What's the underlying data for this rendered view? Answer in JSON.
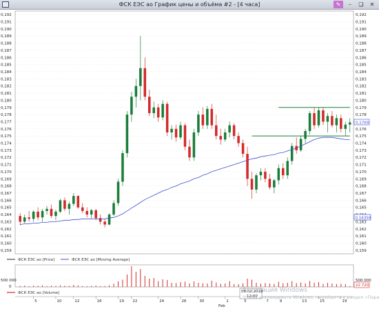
{
  "window": {
    "title": "ФСК ЕЭС ао График цены и объёма #2 - [4 часа]",
    "buttons": {
      "highlight": "✎",
      "minimize": "–",
      "restore": "❏",
      "close": "✕"
    }
  },
  "colors": {
    "up": "#1b7d3a",
    "down": "#d22a2a",
    "ma": "#3a4fd2",
    "volume": "#d22a2a",
    "grid": "#d6d6d6",
    "level_line": "#1b7d3a"
  },
  "price_axis": {
    "ticks": [
      "0,159",
      "0,160",
      "0,161",
      "0,162",
      "0,163",
      "0,164",
      "0,165",
      "0,166",
      "0,167",
      "0,168",
      "0,169",
      "0,170",
      "0,171",
      "0,172",
      "0,173",
      "0,174",
      "0,175",
      "0,176",
      "0,177",
      "0,178",
      "0,179",
      "0,180",
      "0,181",
      "0,182",
      "0,183",
      "0,184",
      "0,185",
      "0,186",
      "0,187",
      "0,188",
      "0,189",
      "0,190",
      "0,191",
      "0,192"
    ],
    "min": 0.1585,
    "max": 0.1925,
    "last_price_label": "0,1769",
    "ma_price_label": "0,16358"
  },
  "legend": {
    "price": "ФСК ЕЭС ао [Price]",
    "ma": "ФСК ЕЭС ао [Moving Average]",
    "volume": "ФСК ЕЭС ао [Volume]"
  },
  "volume_axis": {
    "ticks": [
      "500 000",
      "0"
    ],
    "last_label": "22 720"
  },
  "time_axis": {
    "labels": [
      "5",
      "10",
      "12",
      "16",
      "19",
      "22",
      "24",
      "26",
      "30",
      "1",
      "5",
      "7",
      "9",
      "13",
      "15",
      "19"
    ],
    "month_label": "Feb",
    "crosshair_date": "06.02.2018",
    "crosshair_time": "12:00"
  },
  "level_lines": [
    0.179,
    0.175
  ],
  "watermark": {
    "line1": "Активация Windows",
    "line2": "Чтобы активировать Windows, перейдите в раздел «Параметры»."
  },
  "chart_data": {
    "type": "candlestick",
    "series": [
      {
        "name": "ФСК ЕЭС ао [Price]",
        "candles": [
          [
            0.1638,
            0.1642,
            0.1625,
            0.163
          ],
          [
            0.163,
            0.164,
            0.1628,
            0.1636
          ],
          [
            0.1636,
            0.1645,
            0.163,
            0.1634
          ],
          [
            0.1634,
            0.1646,
            0.163,
            0.1644
          ],
          [
            0.1644,
            0.165,
            0.1632,
            0.1636
          ],
          [
            0.1636,
            0.1648,
            0.163,
            0.1645
          ],
          [
            0.1645,
            0.1652,
            0.164,
            0.1648
          ],
          [
            0.1648,
            0.1654,
            0.1635,
            0.1638
          ],
          [
            0.1638,
            0.1647,
            0.1632,
            0.1644
          ],
          [
            0.1644,
            0.1662,
            0.1642,
            0.166
          ],
          [
            0.166,
            0.1664,
            0.1645,
            0.1648
          ],
          [
            0.1648,
            0.1658,
            0.164,
            0.1655
          ],
          [
            0.1655,
            0.167,
            0.1652,
            0.1666
          ],
          [
            0.1666,
            0.1667,
            0.1648,
            0.165
          ],
          [
            0.165,
            0.1656,
            0.1642,
            0.1645
          ],
          [
            0.1645,
            0.165,
            0.1636,
            0.164
          ],
          [
            0.164,
            0.1648,
            0.1635,
            0.1646
          ],
          [
            0.1646,
            0.1648,
            0.1632,
            0.1635
          ],
          [
            0.1635,
            0.164,
            0.1626,
            0.163
          ],
          [
            0.163,
            0.1634,
            0.1622,
            0.1626
          ],
          [
            0.1626,
            0.1642,
            0.1625,
            0.164
          ],
          [
            0.164,
            0.166,
            0.1638,
            0.1656
          ],
          [
            0.1656,
            0.169,
            0.1652,
            0.1686
          ],
          [
            0.1686,
            0.173,
            0.168,
            0.1726
          ],
          [
            0.1726,
            0.1785,
            0.172,
            0.178
          ],
          [
            0.178,
            0.1812,
            0.177,
            0.1805
          ],
          [
            0.1805,
            0.183,
            0.179,
            0.182
          ],
          [
            0.182,
            0.189,
            0.18,
            0.1845
          ],
          [
            0.1845,
            0.186,
            0.18,
            0.1805
          ],
          [
            0.1805,
            0.1815,
            0.1778,
            0.1782
          ],
          [
            0.1782,
            0.1798,
            0.1775,
            0.179
          ],
          [
            0.179,
            0.1795,
            0.177,
            0.1776
          ],
          [
            0.1776,
            0.18,
            0.1772,
            0.1795
          ],
          [
            0.1795,
            0.1798,
            0.175,
            0.1755
          ],
          [
            0.1755,
            0.1765,
            0.1745,
            0.176
          ],
          [
            0.176,
            0.1766,
            0.1742,
            0.1748
          ],
          [
            0.1748,
            0.177,
            0.1745,
            0.1765
          ],
          [
            0.1765,
            0.1768,
            0.173,
            0.1735
          ],
          [
            0.1735,
            0.1745,
            0.1715,
            0.172
          ],
          [
            0.172,
            0.176,
            0.1715,
            0.1755
          ],
          [
            0.1755,
            0.1785,
            0.175,
            0.178
          ],
          [
            0.178,
            0.179,
            0.176,
            0.1765
          ],
          [
            0.1765,
            0.1792,
            0.176,
            0.1788
          ],
          [
            0.1788,
            0.1795,
            0.176,
            0.1765
          ],
          [
            0.1765,
            0.178,
            0.1745,
            0.175
          ],
          [
            0.175,
            0.176,
            0.1738,
            0.1745
          ],
          [
            0.1745,
            0.176,
            0.1742,
            0.1755
          ],
          [
            0.1755,
            0.177,
            0.1748,
            0.1765
          ],
          [
            0.1765,
            0.1768,
            0.1745,
            0.175
          ],
          [
            0.175,
            0.1755,
            0.1735,
            0.174
          ],
          [
            0.174,
            0.1745,
            0.172,
            0.1725
          ],
          [
            0.1725,
            0.1735,
            0.168,
            0.169
          ],
          [
            0.169,
            0.17,
            0.1662,
            0.1675
          ],
          [
            0.1675,
            0.1698,
            0.167,
            0.1695
          ],
          [
            0.1695,
            0.1705,
            0.1688,
            0.17
          ],
          [
            0.17,
            0.1705,
            0.1685,
            0.169
          ],
          [
            0.169,
            0.1697,
            0.1675,
            0.1678
          ],
          [
            0.1678,
            0.169,
            0.167,
            0.1688
          ],
          [
            0.1688,
            0.171,
            0.1682,
            0.1705
          ],
          [
            0.1705,
            0.1712,
            0.169,
            0.1695
          ],
          [
            0.1695,
            0.172,
            0.169,
            0.1715
          ],
          [
            0.1715,
            0.174,
            0.171,
            0.1736
          ],
          [
            0.1736,
            0.1748,
            0.1725,
            0.173
          ],
          [
            0.173,
            0.175,
            0.1728,
            0.1746
          ],
          [
            0.1746,
            0.176,
            0.174,
            0.1757
          ],
          [
            0.1757,
            0.1785,
            0.1752,
            0.1782
          ],
          [
            0.1782,
            0.179,
            0.176,
            0.1765
          ],
          [
            0.1765,
            0.179,
            0.1762,
            0.1786
          ],
          [
            0.1786,
            0.179,
            0.1765,
            0.177
          ],
          [
            0.177,
            0.1782,
            0.1755,
            0.1778
          ],
          [
            0.1778,
            0.1785,
            0.1762,
            0.1765
          ],
          [
            0.1765,
            0.178,
            0.1755,
            0.1775
          ],
          [
            0.1775,
            0.178,
            0.1755,
            0.176
          ],
          [
            0.176,
            0.177,
            0.175,
            0.1766
          ],
          [
            0.1766,
            0.1775,
            0.1755,
            0.1769
          ]
        ]
      },
      {
        "name": "ФСК ЕЭС ао [Moving Average]",
        "values": [
          0.1626,
          0.1627,
          0.1627,
          0.1628,
          0.1628,
          0.1629,
          0.1629,
          0.163,
          0.163,
          0.1631,
          0.1632,
          0.1632,
          0.1633,
          0.1633,
          0.1634,
          0.1634,
          0.1634,
          0.1634,
          0.1634,
          0.1634,
          0.1635,
          0.1636,
          0.1638,
          0.1641,
          0.1645,
          0.1649,
          0.1653,
          0.1657,
          0.1661,
          0.1664,
          0.1667,
          0.167,
          0.1673,
          0.1675,
          0.1678,
          0.168,
          0.1683,
          0.1685,
          0.1687,
          0.169,
          0.1692,
          0.1695,
          0.1697,
          0.17,
          0.1702,
          0.1704,
          0.1706,
          0.1708,
          0.171,
          0.1712,
          0.1714,
          0.1716,
          0.1718,
          0.1719,
          0.1721,
          0.1722,
          0.1723,
          0.1724,
          0.1726,
          0.1727,
          0.1729,
          0.1731,
          0.1733,
          0.1736,
          0.1739,
          0.1742,
          0.1745,
          0.1747,
          0.1748,
          0.1748,
          0.1748,
          0.1747,
          0.1746,
          0.1745,
          0.1745
        ]
      },
      {
        "name": "ФСК ЕЭС ао [Volume]",
        "values": [
          70,
          100,
          60,
          90,
          80,
          110,
          60,
          90,
          70,
          120,
          90,
          80,
          150,
          110,
          70,
          60,
          80,
          100,
          60,
          70,
          120,
          230,
          400,
          520,
          900,
          1500,
          1100,
          1300,
          800,
          600,
          650,
          420,
          550,
          500,
          300,
          280,
          350,
          380,
          250,
          400,
          300,
          270,
          250,
          450,
          320,
          230,
          250,
          420,
          210,
          200,
          260,
          600,
          520,
          300,
          240,
          280,
          250,
          220,
          380,
          260,
          300,
          420,
          280,
          320,
          260,
          430,
          300,
          350,
          220,
          300,
          250,
          210,
          230,
          200,
          60
        ]
      }
    ]
  }
}
